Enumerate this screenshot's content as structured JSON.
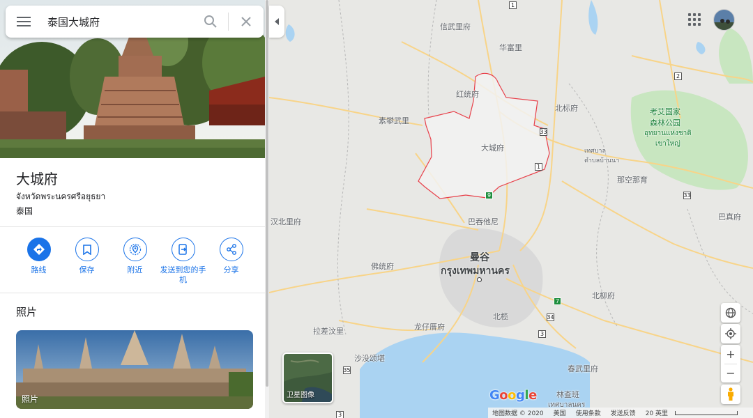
{
  "search": {
    "value": "泰国大城府"
  },
  "place": {
    "title": "大城府",
    "subtitle": "จังหวัดพระนครศรีอยุธยา",
    "country": "泰国"
  },
  "actions": [
    {
      "label": "路线",
      "icon": "directions-icon"
    },
    {
      "label": "保存",
      "icon": "bookmark-icon"
    },
    {
      "label": "附近",
      "icon": "nearby-icon"
    },
    {
      "label": "发送到您的手机",
      "icon": "send-to-phone-icon"
    },
    {
      "label": "分享",
      "icon": "share-icon"
    }
  ],
  "photos": {
    "section_title": "照片",
    "card_label": "照片"
  },
  "map": {
    "labels": {
      "xinwuli": "信武里府",
      "huafuli": "华富里",
      "hongtong": "红统府",
      "supanburi": "素攀武里",
      "beibiao": "北标府",
      "khaoyai": "考艾国家\n森林公园",
      "khaoyai_th": "อุทยานแห่งชาติ\nเขาใหญ่",
      "ayutthaya": "大城府",
      "thesaban": "เทศบาล\nตำบลบ้านนา",
      "nakhonnayok": "那空那育",
      "hanbuli": "汉北里府",
      "batuntani": "巴吞他尼",
      "bazhen": "巴真府",
      "mangu": "曼谷",
      "bangkok_th": "กรุงเทพมหานคร",
      "fotongfu": "佛统府",
      "beiliu": "北柳府",
      "beilan": "北榄",
      "lachaburi": "拉差汶里",
      "longzi": "龙仔厝府",
      "shameiding": "沙没颂堪",
      "chunwuli": "春武里府",
      "lincha": "林查班",
      "lincha_th": "เทศบาลนคร"
    },
    "shields": [
      "1",
      "2",
      "33",
      "1",
      "33",
      "9",
      "7",
      "34",
      "3",
      "35",
      "3"
    ],
    "satellite_label": "卫星图像",
    "logo": "Google",
    "footer": {
      "data": "地图数据 © 2020",
      "country": "美国",
      "terms": "使用条款",
      "feedback": "发送反馈",
      "scale": "20 英里"
    }
  },
  "colors": {
    "accent": "#1a73e8",
    "boundary": "#e8404a",
    "water": "#aad3f2",
    "road": "#f8d488"
  }
}
